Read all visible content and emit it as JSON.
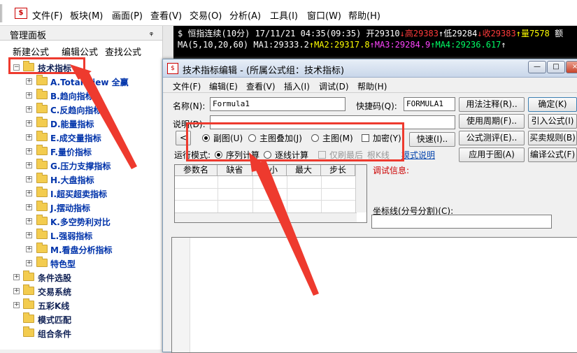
{
  "menubar": {
    "items": [
      "文件(F)",
      "板块(M)",
      "画面(P)",
      "查看(V)",
      "交易(O)",
      "分析(A)",
      "工具(I)",
      "窗口(W)",
      "帮助(H)"
    ]
  },
  "panel": {
    "title": "管理面板",
    "pin": "ᵩ",
    "close": "×",
    "toolbar": [
      "新建公式",
      "编辑公式",
      "查找公式"
    ]
  },
  "tree": {
    "root": "技术指标",
    "children": [
      "A.Total View 全赢",
      "B.趋向指标",
      "C.反趋向指标",
      "D.能量指标",
      "E.成交量指标",
      "F.量价指标",
      "G.压力支撑指标",
      "H.大盘指标",
      "I.超买超卖指标",
      "J.摆动指标",
      "K.多空势利对比",
      "L.强弱指标",
      "M.看盘分析指标",
      "特色型"
    ],
    "others": [
      "条件选股",
      "交易系统",
      "五彩K线",
      "模式匹配",
      "组合条件"
    ]
  },
  "quote": {
    "line1": [
      {
        "text": "$ 恒指连续(10分) 17/11/21 04:35(09:35) 开29310",
        "color": "#ffffff"
      },
      {
        "text": "↓高29383",
        "color": "#ff3b3b"
      },
      {
        "text": "↑低29284",
        "color": "#ffffff"
      },
      {
        "text": "↓收29383",
        "color": "#ff3b3b"
      },
      {
        "text": "↑量7578",
        "color": "#ffff00"
      },
      {
        "text": " 额",
        "color": "#ffffff"
      }
    ],
    "line2": [
      {
        "text": "MA(5,10,20,60) MA1:29333.2",
        "color": "#ffffff"
      },
      {
        "text": "↑MA2:29317.8",
        "color": "#ffff00"
      },
      {
        "text": "↑MA3:29284.9",
        "color": "#ff44ff"
      },
      {
        "text": "↑MA4:29236.617",
        "color": "#00ff66"
      },
      {
        "text": "↑",
        "color": "#ffffff"
      }
    ]
  },
  "dialog": {
    "title": "技术指标编辑 - (所属公式组：技术指标)",
    "menu": [
      "文件(F)",
      "编辑(E)",
      "查看(V)",
      "插入(I)",
      "调试(D)",
      "帮助(H)"
    ],
    "name_label": "名称(N):",
    "name_value": "Formula1",
    "hotkey_label": "快捷码(Q):",
    "hotkey_value": "FORMULA1",
    "desc_label": "说明(D):",
    "desc_value": "",
    "prev_button": "<",
    "radio_sub": "副图(U)",
    "radio_overlay": "主图叠加(J)",
    "radio_main": "主图(M)",
    "encrypt": "加密(Y)",
    "fast_button": "快速(I)..",
    "run_mode_label": "运行模式:",
    "run_seq": "序列计算",
    "run_step": "逐线计算",
    "only_last": "仅刷最后",
    "root_line": "根K线",
    "mode_help": "模式说明",
    "table_headers": [
      "参数名",
      "缺省",
      "最小",
      "最大",
      "步长"
    ],
    "debug_label": "调试信息:",
    "axis_label": "坐标线(分号分割)(C):",
    "axis_value": "",
    "buttons": {
      "usage": "用法注释(R)..",
      "confirm": "确定(K)",
      "period": "使用周期(F)..",
      "import": "引入公式(I)",
      "test": "公式测评(E)..",
      "rules": "买卖规则(B)",
      "apply": "应用于图(A)",
      "compile": "编译公式(F)"
    },
    "window_buttons": {
      "min": "—",
      "max": "□",
      "close": "×"
    }
  },
  "colors": {
    "highlight": "#ee3a2e",
    "tree_text": "#0033aa",
    "debug_text": "#cc0000"
  }
}
